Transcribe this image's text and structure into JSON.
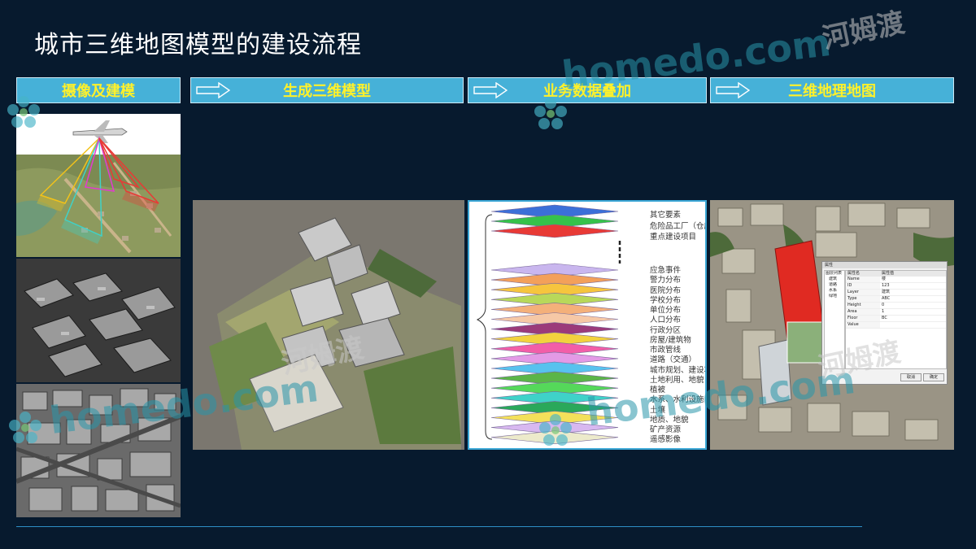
{
  "page": {
    "title": "城市三维地图模型的建设流程"
  },
  "steps": [
    {
      "label": "摄像及建模",
      "has_arrow": false
    },
    {
      "label": "生成三维模型",
      "has_arrow": true
    },
    {
      "label": "业务数据叠加",
      "has_arrow": true
    },
    {
      "label": "三维地理地图",
      "has_arrow": true
    }
  ],
  "layers": {
    "top_labels": [
      "其它要素",
      "危险品工厂（仓库）",
      "重点建设项目"
    ],
    "bottom_labels": [
      "应急事件",
      "警力分布",
      "医院分布",
      "学校分布",
      "单位分布",
      "人口分布",
      "行政分区",
      "房屋/建筑物",
      "市政管线",
      "道路（交通）",
      "城市规划、建设项目",
      "土地利用、地貌",
      "植被",
      "水系、水利设施",
      "土壤",
      "地质、地貌",
      "矿产资源",
      "遥感影像"
    ],
    "top_colors": [
      "#3b6fd8",
      "#35c24a",
      "#e83a36"
    ],
    "bottom_colors": [
      "#c9b6ee",
      "#f3a05a",
      "#f6c53e",
      "#b8d85a",
      "#f4b07a",
      "#f6c8a6",
      "#9b3a7a",
      "#f2d23e",
      "#f25ea8",
      "#e39ae6",
      "#57c2ee",
      "#5bb548",
      "#55d85a",
      "#3fd2c8",
      "#2aa85a",
      "#f3e05a",
      "#d8b8f0",
      "#eceacb"
    ]
  },
  "attr_window": {
    "title": "属性",
    "col_headers": [
      "属性名",
      "属性值"
    ],
    "tree": [
      "图层列表",
      "建筑",
      "道路",
      "水系",
      "绿地"
    ],
    "rows": [
      [
        "Name",
        "楼"
      ],
      [
        "ID",
        "123"
      ],
      [
        "Layer",
        "建筑"
      ],
      [
        "Type",
        "ABC"
      ],
      [
        "Height",
        "0"
      ],
      [
        "Area",
        "1"
      ],
      [
        "Floor",
        "BC"
      ],
      [
        "Value",
        ""
      ]
    ],
    "buttons": [
      "取消",
      "确定"
    ]
  },
  "watermarks": {
    "en": "homedo.com",
    "cn": "河姆渡"
  }
}
